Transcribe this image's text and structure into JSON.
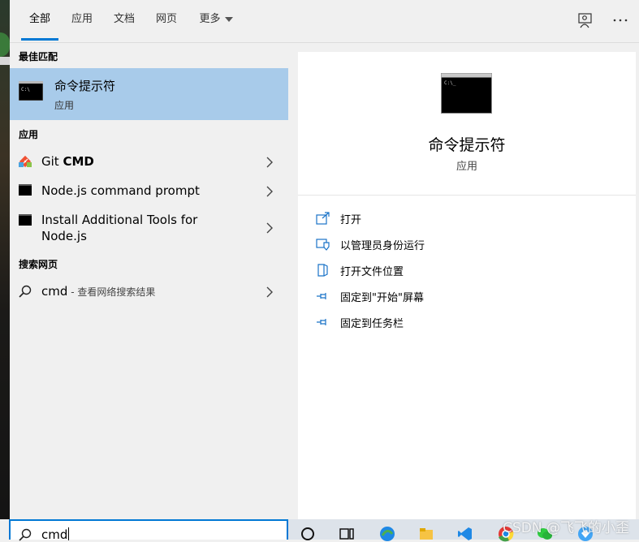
{
  "tabs": [
    {
      "label": "全部"
    },
    {
      "label": "应用"
    },
    {
      "label": "文档"
    },
    {
      "label": "网页"
    },
    {
      "label": "更多"
    }
  ],
  "top_icons": [
    "feedback-icon",
    "more-options-icon"
  ],
  "left_pane": {
    "best_match_heading": "最佳匹配",
    "best_match": {
      "title": "命令提示符",
      "subtitle": "应用",
      "icon": "command-prompt-icon"
    },
    "apps_heading": "应用",
    "apps": [
      {
        "label_prefix": "Git ",
        "label_bold": "CMD",
        "icon": "git-icon"
      },
      {
        "label": "Node.js command prompt",
        "icon": "console-icon"
      },
      {
        "label_line1": "Install Additional Tools for",
        "label_line2": "Node.js",
        "icon": "console-icon"
      }
    ],
    "web_heading": "搜索网页",
    "web_result": {
      "query": "cmd",
      "suffix": " - 查看网络搜索结果",
      "icon": "search-icon"
    }
  },
  "right_pane": {
    "title": "命令提示符",
    "subtitle": "应用",
    "actions": [
      {
        "label": "打开",
        "icon": "open-icon"
      },
      {
        "label": "以管理员身份运行",
        "icon": "run-as-admin-icon"
      },
      {
        "label": "打开文件位置",
        "icon": "file-location-icon"
      },
      {
        "label": "固定到\"开始\"屏幕",
        "icon": "pin-icon"
      },
      {
        "label": "固定到任务栏",
        "icon": "pin-icon"
      }
    ]
  },
  "search": {
    "value": "cmd"
  },
  "watermark": "CSDN @飞飞的小歪",
  "colors": {
    "accent": "#0078d4",
    "selected_bg": "#a8cbea",
    "panel_bg": "#f0f0f0"
  }
}
